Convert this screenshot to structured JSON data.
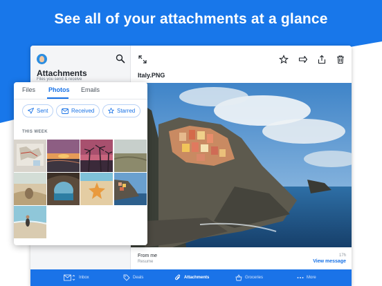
{
  "headline": "See all of your attachments at a glance",
  "colors": {
    "brand_blue": "#1877ea",
    "accent": "#1570e6"
  },
  "left_pane": {
    "title": "Attachments",
    "subtitle": "Files you send & receive"
  },
  "popover": {
    "tabs": [
      {
        "label": "Files",
        "active": false
      },
      {
        "label": "Photos",
        "active": true
      },
      {
        "label": "Emails",
        "active": false
      }
    ],
    "filters": [
      {
        "label": "Sent",
        "icon": "send-icon"
      },
      {
        "label": "Received",
        "icon": "mail-icon"
      },
      {
        "label": "Starred",
        "icon": "star-icon"
      }
    ],
    "section_label": "THIS WEEK",
    "thumbnails": [
      "map-photo",
      "sunset-photo",
      "palm-trees-photo",
      "field-photo",
      "desert-photo",
      "sea-cave-photo",
      "starfish-photo",
      "cinque-terre-photo",
      "beach-person-photo"
    ]
  },
  "viewer": {
    "filename": "Italy.PNG",
    "toolbar_icons": [
      "expand-icon",
      "star-icon",
      "forward-icon",
      "share-icon",
      "trash-icon"
    ],
    "from": "From me",
    "subject": "Resume",
    "time": "17h",
    "view_message": "View message"
  },
  "bottom_nav": [
    {
      "label": "Inbox",
      "icon": "inbox-icon",
      "active": false
    },
    {
      "label": "Deals",
      "icon": "tag-icon",
      "active": false
    },
    {
      "label": "Attachments",
      "icon": "paperclip-icon",
      "active": true
    },
    {
      "label": "Groceries",
      "icon": "basket-icon",
      "active": false
    },
    {
      "label": "More",
      "icon": "more-icon",
      "active": false
    }
  ]
}
